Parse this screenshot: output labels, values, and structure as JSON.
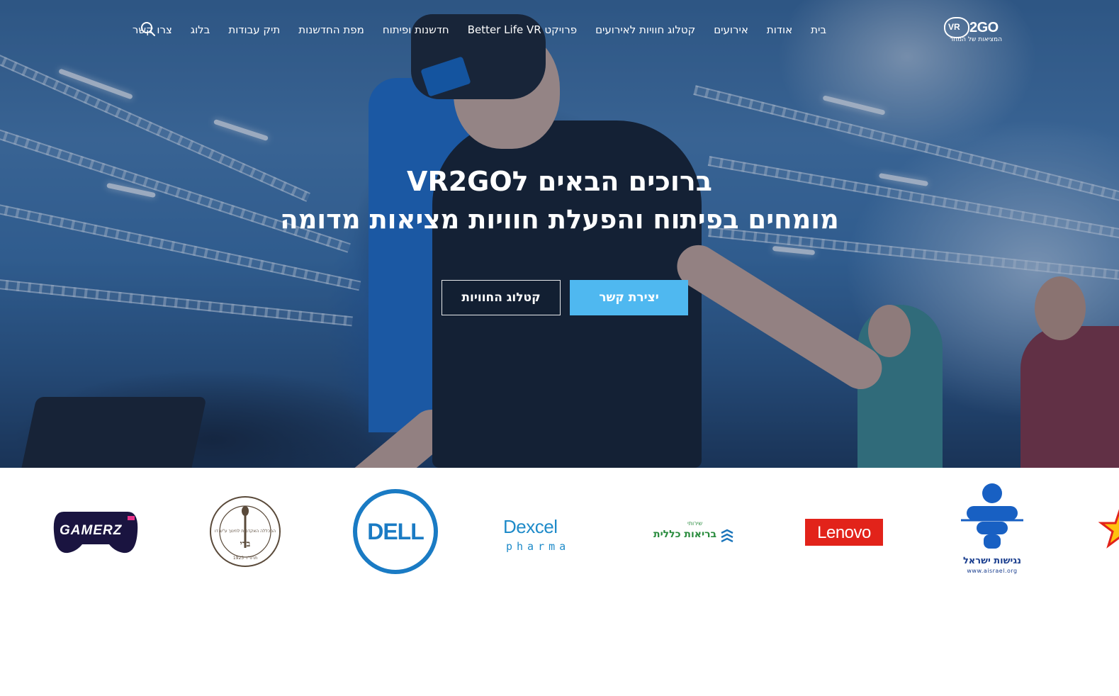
{
  "logo": {
    "mark_text": "VR",
    "brand_text": "2GO",
    "tagline": "המציאות של המחר"
  },
  "nav": {
    "items": [
      {
        "label": "בית"
      },
      {
        "label": "אודות"
      },
      {
        "label": "אירועים"
      },
      {
        "label": "קטלוג חוויות לאירועים"
      },
      {
        "label": "פרויקט Better Life VR"
      },
      {
        "label": "חדשנות ופיתוח"
      },
      {
        "label": "מפת החדשנות"
      },
      {
        "label": "תיק עבודות"
      },
      {
        "label": "בלוג"
      },
      {
        "label": "צרו קשר"
      }
    ],
    "search_icon": "search-icon"
  },
  "hero": {
    "headline_line1": "ברוכים הבאים לVR2GO",
    "headline_line2": "מומחים בפיתוח והפעלת חוויות מציאות מדומה",
    "cta_contact": "יצירת קשר",
    "cta_catalog": "קטלוג החוויות",
    "accent_color": "#4fb8f0"
  },
  "partners": {
    "gamerz": "GAMERZ",
    "academy_top": "המכללה האקדמית לחינוך ע\"ש דוד ילין",
    "academy_mid": "בדי",
    "academy_bottom": "תרפ\"ד 1923",
    "dell": "DELL",
    "dexcel_top": "Dexcel",
    "dexcel_bottom": "pharma",
    "clalit_top": "שירותי",
    "clalit_main": "בריאות כללית",
    "lenovo": "Lenovo",
    "access_main": "נגישות ישראל",
    "access_url": "www.aisrael.org"
  }
}
